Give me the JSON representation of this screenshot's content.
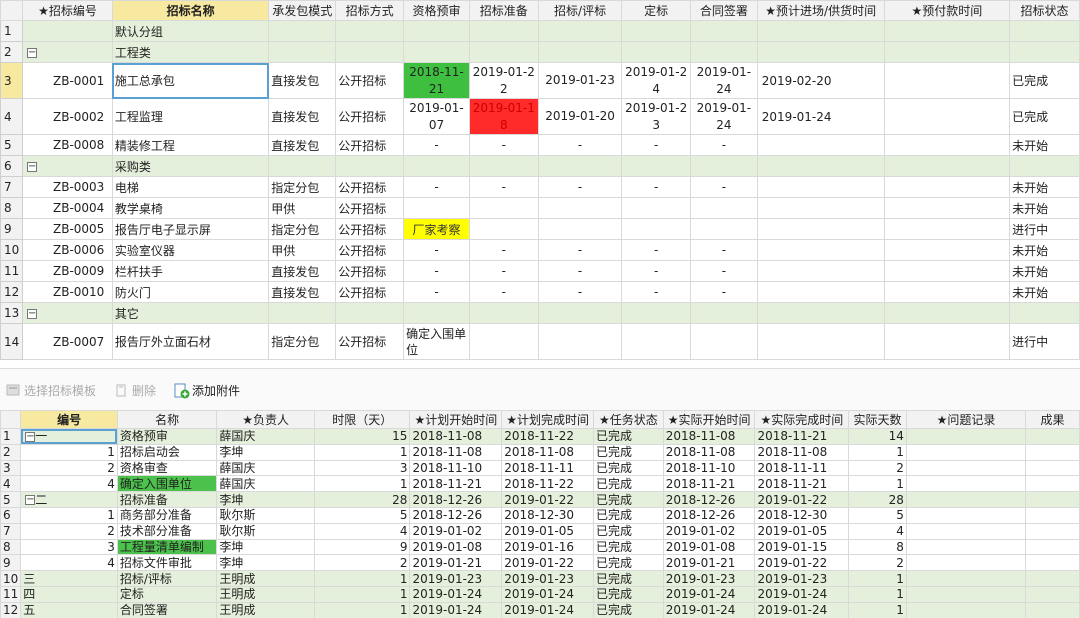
{
  "top": {
    "headers": [
      "★招标编号",
      "招标名称",
      "承发包模式",
      "招标方式",
      "资格预审",
      "招标准备",
      "招标/评标",
      "定标",
      "合同签署",
      "★预计进场/供货时间",
      "★预付款时间",
      "招标状态"
    ],
    "rows": [
      {
        "n": "1",
        "type": "grp",
        "name": "默认分组"
      },
      {
        "n": "2",
        "type": "grp",
        "toggle": "−",
        "name": "工程类"
      },
      {
        "n": "3",
        "type": "item",
        "code": "ZB-0001",
        "name": "施工总承包",
        "mode": "直接发包",
        "method": "公开招标",
        "c1": "2018-11-21",
        "c2": "2019-01-22",
        "c3": "2019-01-23",
        "c4": "2019-01-24",
        "c5": "2019-01-24",
        "c6": "2019-02-20",
        "c7": "",
        "status": "已完成",
        "h1": "green"
      },
      {
        "n": "4",
        "type": "item",
        "code": "ZB-0002",
        "name": "工程监理",
        "mode": "直接发包",
        "method": "公开招标",
        "c1": "2019-01-07",
        "c2": "2019-01-18",
        "c3": "2019-01-20",
        "c4": "2019-01-23",
        "c5": "2019-01-24",
        "c6": "2019-01-24",
        "c7": "",
        "status": "已完成",
        "h2": "red"
      },
      {
        "n": "5",
        "type": "item",
        "code": "ZB-0008",
        "name": "精装修工程",
        "mode": "直接发包",
        "method": "公开招标",
        "c1": "-",
        "c2": "-",
        "c3": "-",
        "c4": "-",
        "c5": "-",
        "c6": "",
        "c7": "",
        "status": "未开始"
      },
      {
        "n": "6",
        "type": "grp",
        "toggle": "−",
        "name": "采购类"
      },
      {
        "n": "7",
        "type": "item",
        "code": "ZB-0003",
        "name": "电梯",
        "mode": "指定分包",
        "method": "公开招标",
        "c1": "-",
        "c2": "-",
        "c3": "-",
        "c4": "-",
        "c5": "-",
        "c6": "",
        "c7": "",
        "status": "未开始"
      },
      {
        "n": "8",
        "type": "item",
        "code": "ZB-0004",
        "name": "教学桌椅",
        "mode": "甲供",
        "method": "公开招标",
        "c1": "",
        "c2": "",
        "c3": "",
        "c4": "",
        "c5": "",
        "c6": "",
        "c7": "",
        "status": "未开始"
      },
      {
        "n": "9",
        "type": "item",
        "code": "ZB-0005",
        "name": "报告厅电子显示屏",
        "mode": "指定分包",
        "method": "公开招标",
        "c1": "厂家考察",
        "c2": "",
        "c3": "",
        "c4": "",
        "c5": "",
        "c6": "",
        "c7": "",
        "status": "进行中",
        "h1": "yellow"
      },
      {
        "n": "10",
        "type": "item",
        "code": "ZB-0006",
        "name": "实验室仪器",
        "mode": "甲供",
        "method": "公开招标",
        "c1": "-",
        "c2": "-",
        "c3": "-",
        "c4": "-",
        "c5": "-",
        "c6": "",
        "c7": "",
        "status": "未开始"
      },
      {
        "n": "11",
        "type": "item",
        "code": "ZB-0009",
        "name": "栏杆扶手",
        "mode": "直接发包",
        "method": "公开招标",
        "c1": "-",
        "c2": "-",
        "c3": "-",
        "c4": "-",
        "c5": "-",
        "c6": "",
        "c7": "",
        "status": "未开始"
      },
      {
        "n": "12",
        "type": "item",
        "code": "ZB-0010",
        "name": "防火门",
        "mode": "直接发包",
        "method": "公开招标",
        "c1": "-",
        "c2": "-",
        "c3": "-",
        "c4": "-",
        "c5": "-",
        "c6": "",
        "c7": "",
        "status": "未开始"
      },
      {
        "n": "13",
        "type": "grp",
        "toggle": "−",
        "name": "其它"
      },
      {
        "n": "14",
        "type": "item",
        "code": "ZB-0007",
        "name": "报告厅外立面石材",
        "mode": "指定分包",
        "method": "公开招标",
        "c1": "确定入围单位",
        "c2": "",
        "c3": "",
        "c4": "",
        "c5": "",
        "c6": "",
        "c7": "",
        "status": "进行中"
      }
    ]
  },
  "toolbar": {
    "select_template": "选择招标模板",
    "delete": "删除",
    "add_attachment": "添加附件"
  },
  "bottom": {
    "headers": [
      "编号",
      "名称",
      "★负责人",
      "时限（天）",
      "★计划开始时间",
      "★计划完成时间",
      "★任务状态",
      "★实际开始时间",
      "★实际完成时间",
      "实际天数",
      "★问题记录",
      "成果"
    ],
    "rows": [
      {
        "n": "1",
        "ph": true,
        "toggle": "−",
        "code": "一",
        "name": "资格预审",
        "owner": "薛国庆",
        "days": "15",
        "ps": "2018-11-08",
        "pe": "2018-11-22",
        "st": "已完成",
        "as": "2018-11-08",
        "ae": "2018-11-21",
        "ad": "14"
      },
      {
        "n": "2",
        "code": "1",
        "name": "招标启动会",
        "owner": "李坤",
        "days": "1",
        "ps": "2018-11-08",
        "pe": "2018-11-08",
        "st": "已完成",
        "as": "2018-11-08",
        "ae": "2018-11-08",
        "ad": "1"
      },
      {
        "n": "3",
        "code": "2",
        "name": "资格审查",
        "owner": "薛国庆",
        "days": "3",
        "ps": "2018-11-10",
        "pe": "2018-11-11",
        "st": "已完成",
        "as": "2018-11-10",
        "ae": "2018-11-11",
        "ad": "2"
      },
      {
        "n": "4",
        "code": "4",
        "name": "确定入围单位",
        "owner": "薛国庆",
        "days": "1",
        "ps": "2018-11-21",
        "pe": "2018-11-22",
        "st": "已完成",
        "as": "2018-11-21",
        "ae": "2018-11-21",
        "ad": "1",
        "hl": true
      },
      {
        "n": "5",
        "ph": true,
        "toggle": "−",
        "code": "二",
        "name": "招标准备",
        "owner": "李坤",
        "days": "28",
        "ps": "2018-12-26",
        "pe": "2019-01-22",
        "st": "已完成",
        "as": "2018-12-26",
        "ae": "2019-01-22",
        "ad": "28"
      },
      {
        "n": "6",
        "code": "1",
        "name": "商务部分准备",
        "owner": "耿尔斯",
        "days": "5",
        "ps": "2018-12-26",
        "pe": "2018-12-30",
        "st": "已完成",
        "as": "2018-12-26",
        "ae": "2018-12-30",
        "ad": "5"
      },
      {
        "n": "7",
        "code": "2",
        "name": "技术部分准备",
        "owner": "耿尔斯",
        "days": "4",
        "ps": "2019-01-02",
        "pe": "2019-01-05",
        "st": "已完成",
        "as": "2019-01-02",
        "ae": "2019-01-05",
        "ad": "4"
      },
      {
        "n": "8",
        "code": "3",
        "name": "工程量清单编制",
        "owner": "李坤",
        "days": "9",
        "ps": "2019-01-08",
        "pe": "2019-01-16",
        "st": "已完成",
        "as": "2019-01-08",
        "ae": "2019-01-15",
        "ad": "8",
        "hl": true
      },
      {
        "n": "9",
        "code": "4",
        "name": "招标文件审批",
        "owner": "李坤",
        "days": "2",
        "ps": "2019-01-21",
        "pe": "2019-01-22",
        "st": "已完成",
        "as": "2019-01-21",
        "ae": "2019-01-22",
        "ad": "2"
      },
      {
        "n": "10",
        "ph": true,
        "code": "三",
        "name": "招标/评标",
        "owner": "王明成",
        "days": "1",
        "ps": "2019-01-23",
        "pe": "2019-01-23",
        "st": "已完成",
        "as": "2019-01-23",
        "ae": "2019-01-23",
        "ad": "1"
      },
      {
        "n": "11",
        "ph": true,
        "code": "四",
        "name": "定标",
        "owner": "王明成",
        "days": "1",
        "ps": "2019-01-24",
        "pe": "2019-01-24",
        "st": "已完成",
        "as": "2019-01-24",
        "ae": "2019-01-24",
        "ad": "1"
      },
      {
        "n": "12",
        "ph": true,
        "code": "五",
        "name": "合同签署",
        "owner": "王明成",
        "days": "1",
        "ps": "2019-01-24",
        "pe": "2019-01-24",
        "st": "已完成",
        "as": "2019-01-24",
        "ae": "2019-01-24",
        "ad": "1"
      }
    ]
  }
}
